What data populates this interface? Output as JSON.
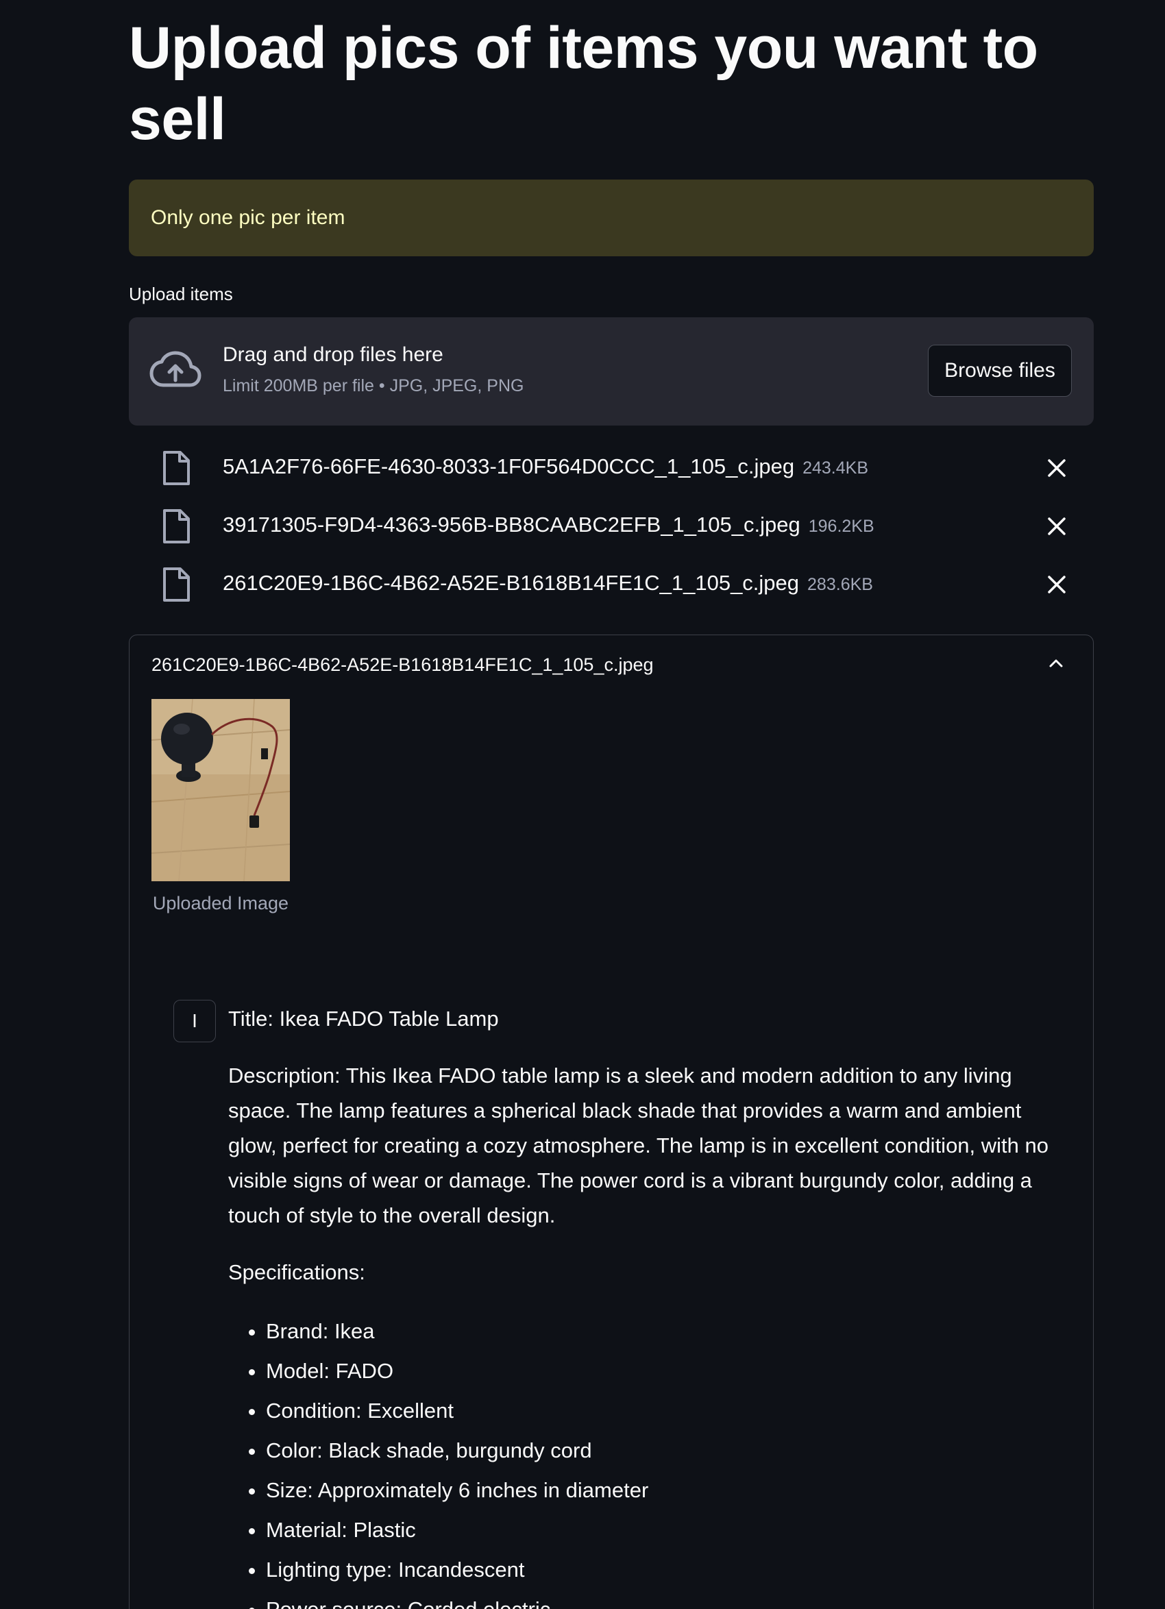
{
  "page": {
    "title": "Upload pics of items you want to sell"
  },
  "warning": {
    "text": "Only one pic per item"
  },
  "uploader": {
    "label": "Upload items",
    "drop_text": "Drag and drop files here",
    "limit_text": "Limit 200MB per file • JPG, JPEG, PNG",
    "browse_label": "Browse files",
    "icon": "cloud-upload-icon"
  },
  "files": [
    {
      "name": "5A1A2F76-66FE-4630-8033-1F0F564D0CCC_1_105_c.jpeg",
      "size": "243.4KB"
    },
    {
      "name": "39171305-F9D4-4363-956B-BB8CAABC2EFB_1_105_c.jpeg",
      "size": "196.2KB"
    },
    {
      "name": "261C20E9-1B6C-4B62-A52E-B1618B14FE1C_1_105_c.jpeg",
      "size": "283.6KB"
    }
  ],
  "expander": {
    "header": "261C20E9-1B6C-4B62-A52E-B1618B14FE1C_1_105_c.jpeg",
    "image_caption": "Uploaded Image"
  },
  "chat": {
    "avatar_letter": "I",
    "title_line": "Title: Ikea FADO Table Lamp",
    "description": "Description: This Ikea FADO table lamp is a sleek and modern addition to any living space. The lamp features a spherical black shade that provides a warm and ambient glow, perfect for creating a cozy atmosphere. The lamp is in excellent condition, with no visible signs of wear or damage. The power cord is a vibrant burgundy color, adding a touch of style to the overall design.",
    "specs_heading": "Specifications:",
    "specs": [
      "Brand: Ikea",
      "Model: FADO",
      "Condition: Excellent",
      "Color: Black shade, burgundy cord",
      "Size: Approximately 6 inches in diameter",
      "Material: Plastic",
      "Lighting type: Incandescent",
      "Power source: Corded electric"
    ]
  },
  "colors": {
    "background": "#0e1117",
    "warning_bg": "#3b3920",
    "warning_text": "#ffffc2",
    "dropzone_bg": "#262730",
    "muted_text": "#a3a8b8"
  }
}
